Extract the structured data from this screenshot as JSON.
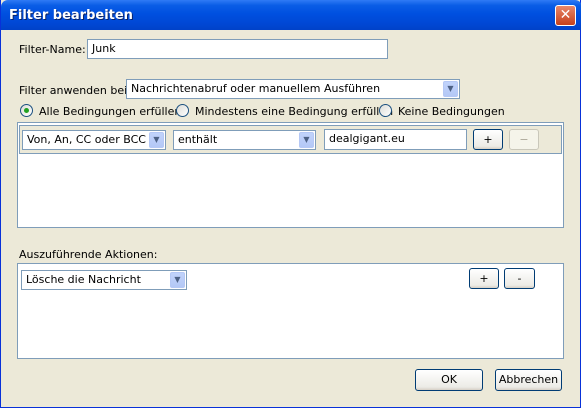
{
  "window": {
    "title": "Filter bearbeiten",
    "close_glyph": "✕"
  },
  "filter_name": {
    "label": "Filter-Name:",
    "value": "Junk"
  },
  "apply_when": {
    "label": "Filter anwenden bei:",
    "selected": "Nachrichtenabruf oder manuellem Ausführen"
  },
  "match_mode": {
    "options": [
      {
        "label": "Alle Bedingungen erfüllen",
        "checked": true
      },
      {
        "label": "Mindestens eine Bedingung erfüllen",
        "checked": false
      },
      {
        "label": "Keine Bedingungen",
        "checked": false
      }
    ]
  },
  "conditions": [
    {
      "field": "Von, An, CC oder BCC",
      "operator": "enthält",
      "value": "dealgigant.eu",
      "add_label": "+",
      "remove_label": "−"
    }
  ],
  "actions_section": {
    "label": "Auszuführende Aktionen:",
    "actions": [
      {
        "action": "Lösche die Nachricht",
        "add_label": "+",
        "remove_label": "-"
      }
    ]
  },
  "footer": {
    "ok_label": "OK",
    "cancel_label": "Abbrechen"
  },
  "colors": {
    "titlebar": "#0050e0",
    "dialog_bg": "#ece9d8",
    "radio_dot": "#21a121"
  }
}
